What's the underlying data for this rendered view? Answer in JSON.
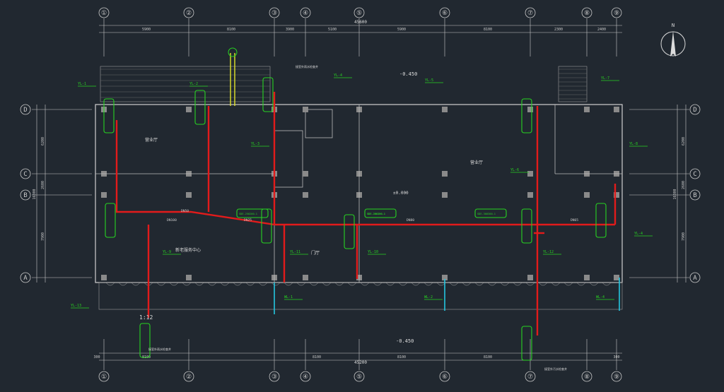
{
  "axes": {
    "numbered": [
      {
        "id": "1",
        "label": "①"
      },
      {
        "id": "2",
        "label": "②"
      },
      {
        "id": "3",
        "label": "③"
      },
      {
        "id": "4",
        "label": "④"
      },
      {
        "id": "5",
        "label": "⑤"
      },
      {
        "id": "6",
        "label": "⑥"
      },
      {
        "id": "7",
        "label": "⑦"
      },
      {
        "id": "8",
        "label": "⑧"
      },
      {
        "id": "9",
        "label": "⑨"
      }
    ],
    "lettered": [
      {
        "id": "D",
        "label": "D"
      },
      {
        "id": "C",
        "label": "C"
      },
      {
        "id": "B",
        "label": "B"
      },
      {
        "id": "A",
        "label": "A"
      }
    ]
  },
  "dimensions": {
    "top_total": "45600",
    "top_segments": [
      "5900",
      "8100",
      "3900",
      "5100",
      "5900",
      "8100",
      "2300",
      "2400"
    ],
    "bottom_total": "45200",
    "bottom_segments": [
      "300",
      "8100",
      "8100",
      "8100",
      "8100",
      "300"
    ],
    "left_total": "16300",
    "left_segments": [
      "6200",
      "2600",
      "7900"
    ],
    "right_total": "16300",
    "right_segments": [
      "6200",
      "2600",
      "7900"
    ],
    "small": [
      "300",
      "300",
      "300",
      "300"
    ]
  },
  "elevations": {
    "top": "-0.450",
    "bottom": "-0.450",
    "center": "±0.000"
  },
  "rooms": [
    "营业厅",
    "营业厅",
    "门厅",
    "新老服务中心"
  ],
  "risers": [
    "YL-1",
    "YL-2",
    "YL-3",
    "YL-4",
    "YL-5",
    "YL-6",
    "YL-7",
    "YL-8",
    "YL-9",
    "YL-10",
    "YL-11",
    "YL-12",
    "YL-13",
    "WL-1",
    "WL-2",
    "WL-4",
    "YL-4"
  ],
  "equipment_tags": [
    "SDE-250250-1",
    "SDE-300300-1",
    "SDE-250200-1",
    "SDE-300300-1"
  ],
  "pipe_labels": [
    "DN100",
    "DN80",
    "DN65",
    "DN50",
    "DN25"
  ],
  "north_arrow": "N",
  "notes": [
    "接室外雨水检查井",
    "接室外雨水检查井",
    "接室外污水检查井"
  ],
  "scale": "1:12",
  "colors": {
    "background": "#212830",
    "grid": "#c9c9c9",
    "pipe_red": "#e21b1b",
    "equipment_green": "#27d321",
    "cyan": "#26c6e0",
    "yellow": "#e3e32c"
  }
}
